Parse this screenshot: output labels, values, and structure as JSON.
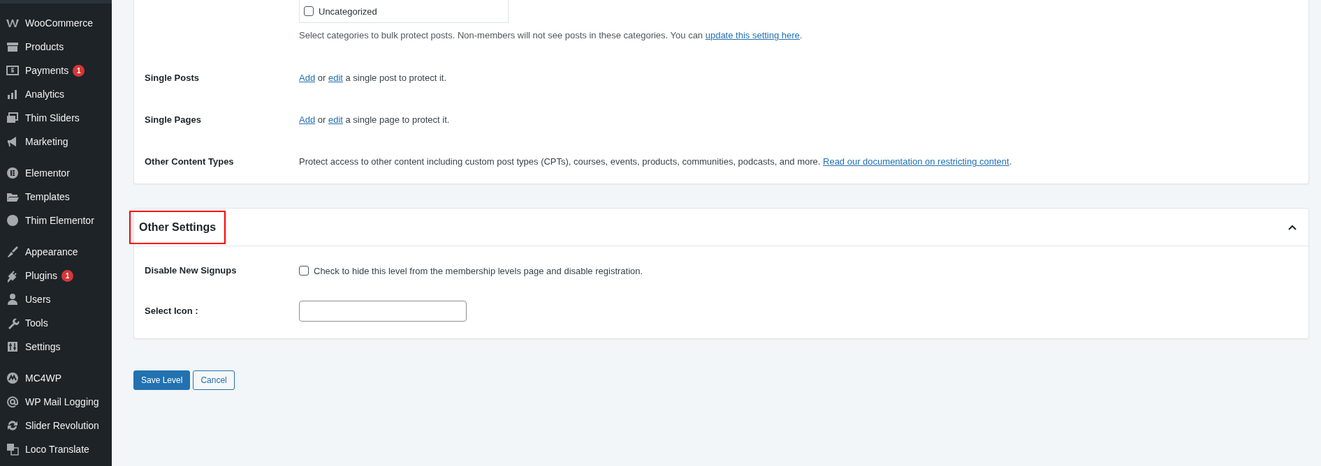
{
  "sidebar": {
    "groups": [
      {
        "items": [
          {
            "label": "WooCommerce"
          },
          {
            "label": "Products"
          },
          {
            "label": "Payments",
            "badge": "1"
          },
          {
            "label": "Analytics"
          },
          {
            "label": "Thim Sliders"
          },
          {
            "label": "Marketing"
          }
        ]
      },
      {
        "items": [
          {
            "label": "Elementor"
          },
          {
            "label": "Templates"
          },
          {
            "label": "Thim Elementor"
          }
        ]
      },
      {
        "items": [
          {
            "label": "Appearance"
          },
          {
            "label": "Plugins",
            "badge": "1"
          },
          {
            "label": "Users"
          },
          {
            "label": "Tools"
          },
          {
            "label": "Settings"
          }
        ]
      },
      {
        "items": [
          {
            "label": "MC4WP"
          },
          {
            "label": "WP Mail Logging"
          },
          {
            "label": "Slider Revolution"
          },
          {
            "label": "Loco Translate"
          }
        ]
      }
    ]
  },
  "content_settings": {
    "categories": [
      {
        "label": "Uncategorized",
        "checked": false
      }
    ],
    "categories_help": [
      {
        "kind": "text",
        "text": "Select categories to bulk protect posts. Non-members will not see posts in these categories. You can "
      },
      {
        "kind": "link",
        "text": "update this setting here"
      },
      {
        "kind": "text",
        "text": "."
      }
    ],
    "rows": [
      {
        "label": "Single Posts",
        "parts": [
          {
            "kind": "link",
            "text": "Add"
          },
          {
            "kind": "text",
            "text": " or "
          },
          {
            "kind": "link",
            "text": "edit"
          },
          {
            "kind": "text",
            "text": " a single post to protect it."
          }
        ]
      },
      {
        "label": "Single Pages",
        "parts": [
          {
            "kind": "link",
            "text": "Add"
          },
          {
            "kind": "text",
            "text": " or "
          },
          {
            "kind": "link",
            "text": "edit"
          },
          {
            "kind": "text",
            "text": " a single page to protect it."
          }
        ]
      },
      {
        "label": "Other Content Types",
        "parts": [
          {
            "kind": "text",
            "text": "Protect access to other content including custom post types (CPTs), courses, events, products, communities, podcasts, and more. "
          },
          {
            "kind": "link",
            "text": "Read our documentation on restricting content"
          },
          {
            "kind": "text",
            "text": "."
          }
        ]
      }
    ]
  },
  "other_settings": {
    "title": "Other Settings",
    "highlighted": true,
    "expanded": true,
    "rows": [
      {
        "kind": "checkbox",
        "label": "Disable New Signups",
        "text": "Check to hide this level from the membership levels page and disable registration.",
        "checked": false
      },
      {
        "kind": "input",
        "label": "Select Icon :"
      }
    ]
  },
  "buttons": [
    {
      "kind": "primary",
      "label": "Save Level"
    },
    {
      "kind": "secondary",
      "label": "Cancel"
    }
  ]
}
